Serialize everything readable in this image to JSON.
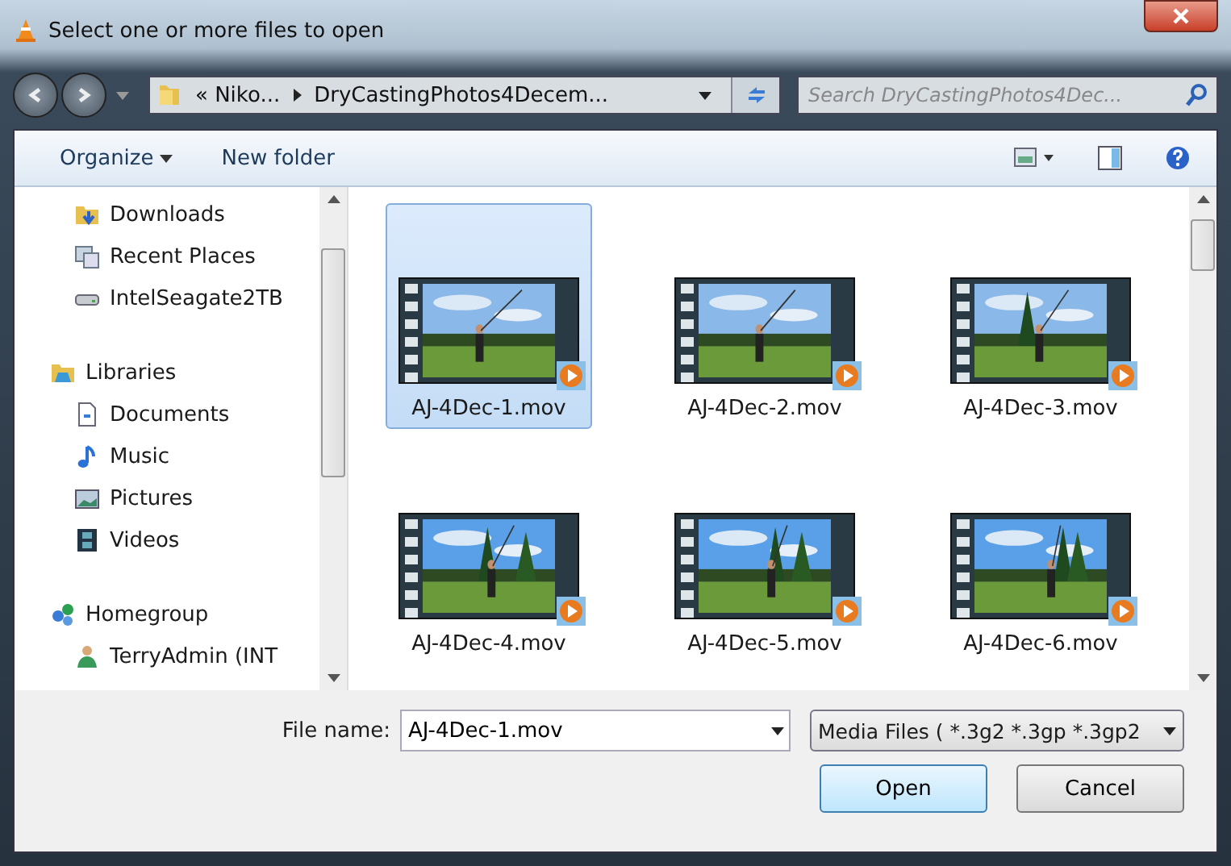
{
  "window": {
    "title": "Select one or more files to open"
  },
  "address": {
    "crumbs": [
      "« Niko...",
      "DryCastingPhotos4Decem..."
    ]
  },
  "search": {
    "placeholder": "Search DryCastingPhotos4Dec..."
  },
  "toolbar": {
    "organize": "Organize",
    "new_folder": "New folder"
  },
  "nav": [
    {
      "items": [
        {
          "label": "Downloads",
          "kind": "downloads"
        },
        {
          "label": "Recent Places",
          "kind": "recent"
        },
        {
          "label": "IntelSeagate2TB",
          "kind": "drive"
        }
      ]
    },
    {
      "label": "Libraries",
      "kind": "libraries",
      "items": [
        {
          "label": "Documents",
          "kind": "documents"
        },
        {
          "label": "Music",
          "kind": "music"
        },
        {
          "label": "Pictures",
          "kind": "pictures"
        },
        {
          "label": "Videos",
          "kind": "videos"
        }
      ]
    },
    {
      "label": "Homegroup",
      "kind": "homegroup",
      "items": [
        {
          "label": "TerryAdmin (INT",
          "kind": "user"
        }
      ]
    }
  ],
  "files": [
    {
      "name": "AJ-4Dec-1.mov",
      "selected": true
    },
    {
      "name": "AJ-4Dec-2.mov",
      "selected": false
    },
    {
      "name": "AJ-4Dec-3.mov",
      "selected": false
    },
    {
      "name": "AJ-4Dec-4.mov",
      "selected": false
    },
    {
      "name": "AJ-4Dec-5.mov",
      "selected": false
    },
    {
      "name": "AJ-4Dec-6.mov",
      "selected": false
    }
  ],
  "file_name": {
    "label": "File name:",
    "value": "AJ-4Dec-1.mov"
  },
  "file_type": "Media Files ( *.3g2 *.3gp *.3gp2",
  "buttons": [
    {
      "label": "Open",
      "kind": "default"
    },
    {
      "label": "Cancel",
      "kind": "normal"
    }
  ]
}
